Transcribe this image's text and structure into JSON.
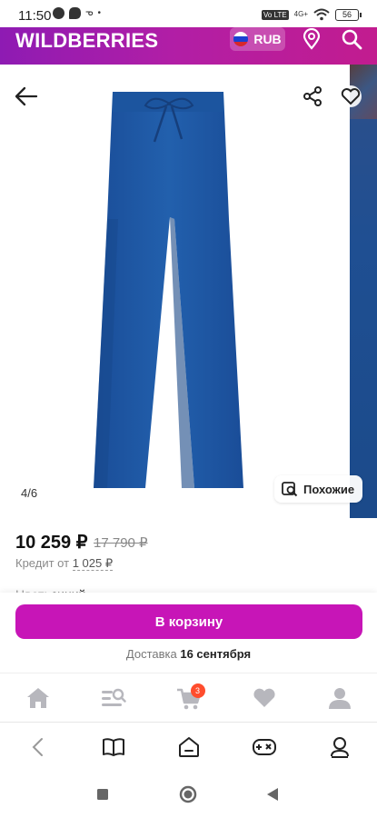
{
  "status_bar": {
    "time": "11:50",
    "volte": "Vo LTE",
    "network": "4G+",
    "battery": "56"
  },
  "header": {
    "brand": "WILDBERRIES",
    "currency": "RUB",
    "icons": [
      "location-icon",
      "search-icon"
    ]
  },
  "gallery": {
    "counter": "4/6",
    "similar_label": "Похожие",
    "icons": [
      "back-arrow-icon",
      "share-icon",
      "heart-icon"
    ]
  },
  "product": {
    "price": "10 259 ₽",
    "old_price": "17 790 ₽",
    "credit_prefix": "Кредит от",
    "credit_amount": "1 025 ₽",
    "color_label": "Цвет:",
    "color_value": "синий"
  },
  "cart": {
    "button_label": "В корзину",
    "delivery_label": "Доставка",
    "delivery_date": "16 сентября",
    "accent_color": "#c715b7"
  },
  "bottom_nav": {
    "items": [
      "home-icon",
      "catalog-search-icon",
      "cart-icon",
      "favorites-icon",
      "profile-icon"
    ],
    "cart_count": "3"
  },
  "browser_bar": {
    "items": [
      "back-icon",
      "bookmarks-icon",
      "home-icon",
      "games-icon",
      "account-icon"
    ]
  },
  "system_nav": {
    "items": [
      "recents-icon",
      "home-circle-icon",
      "back-triangle-icon"
    ]
  }
}
